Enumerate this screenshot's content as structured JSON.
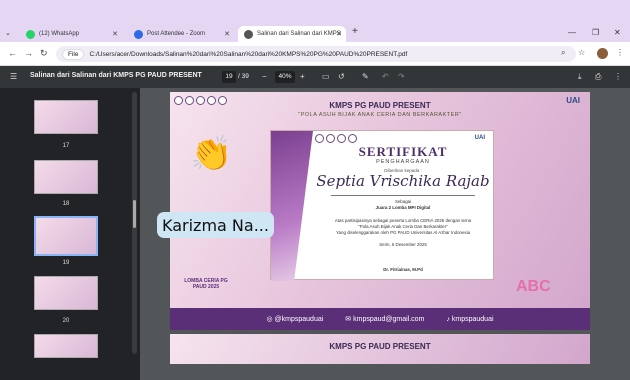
{
  "browser": {
    "tabs": [
      {
        "label": "(12) WhatsApp",
        "color": "#25d366"
      },
      {
        "label": "Post Attendee - Zoom",
        "color": "#2d6be6"
      },
      {
        "label": "Salinan dari Salinan dari KMPS",
        "color": "#555555"
      }
    ],
    "address": "C:/Users/acer/Downloads/Salinan%20dari%20Salinan%20dari%20KMPS%20PG%20PAUD%20PRESENT.pdf",
    "file_chip": "File",
    "new_tab": "+"
  },
  "pdf": {
    "title": "Salinan dari Salinan dari KMPS PG PAUD PRESENT",
    "current_page": "19",
    "total_pages": "/ 39",
    "zoom": "40%",
    "zoom_minus": "−",
    "zoom_plus": "+"
  },
  "thumbnails": [
    {
      "num": "17"
    },
    {
      "num": "18"
    },
    {
      "num": "19"
    },
    {
      "num": "20"
    }
  ],
  "slide": {
    "header": "KMPS PG PAUD PRESENT",
    "tagline": "\"POLA ASUH BIJAK ANAK CERIA DAN BERKARAKTER\"",
    "cert_title": "SERTIFIKAT",
    "cert_subtitle": "PENGHARGAAN",
    "given_to": "Diberikan kepada :",
    "recipient": "Septia Vrischika Rajab",
    "role_label": "Sebagai",
    "award": "Juara 2 Lomba MPI Digital",
    "body_1": "Atas partisipasinya sebagai peserta Lomba CERIA 2025 dengan tema",
    "body_2": "\"Pola Asuh Bijak Anak Ceria Dan Berkarakter\"",
    "body_3": "Yang diselenggarakan oleh PG PAUD Universitas Al Azhar Indonesia",
    "date": "Serin, 6 Desember 2025",
    "signer": "Dr. Fitria/nas, M.Pd",
    "badge": "LOMBA CERIA PG PAUD 2025",
    "social_ig": "@kmpspauduai",
    "social_mail": "kmpspaud@gmail.com",
    "social_tiktok": "kmpspauduai",
    "uai_logo": "UAI",
    "abc": "ABC"
  },
  "overlay": {
    "caption": "Karizma Na..."
  }
}
